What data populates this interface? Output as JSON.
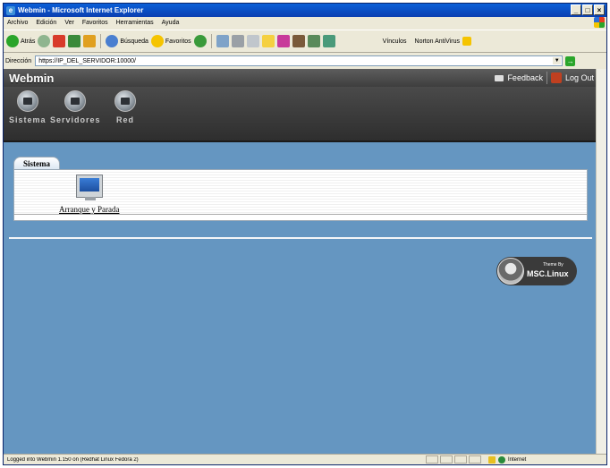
{
  "window": {
    "title": "Webmin - Microsoft Internet Explorer"
  },
  "menu": [
    "Archivo",
    "Edición",
    "Ver",
    "Favoritos",
    "Herramientas",
    "Ayuda"
  ],
  "toolbar": {
    "back": "Atrás",
    "search": "Búsqueda",
    "favorites": "Favoritos",
    "links": "Vínculos",
    "norton": "Norton AntiVirus"
  },
  "address": {
    "label": "Dirección",
    "url": "https://IP_DEL_SERVIDOR:10000/"
  },
  "webmin": {
    "title": "Webmin",
    "feedback": "Feedback",
    "logout": "Log Out",
    "categories": [
      "Sistema",
      "Servidores",
      "Red"
    ]
  },
  "section": {
    "tab": "Sistema",
    "modules": [
      "Arranque y Parada"
    ]
  },
  "theme_badge": {
    "line1": "Theme By",
    "line2": "MSC.Linux"
  },
  "status": {
    "text": "Logged into Webmin 1.150 on (Redhat Linux Fedora 2)",
    "zone": "Internet"
  }
}
